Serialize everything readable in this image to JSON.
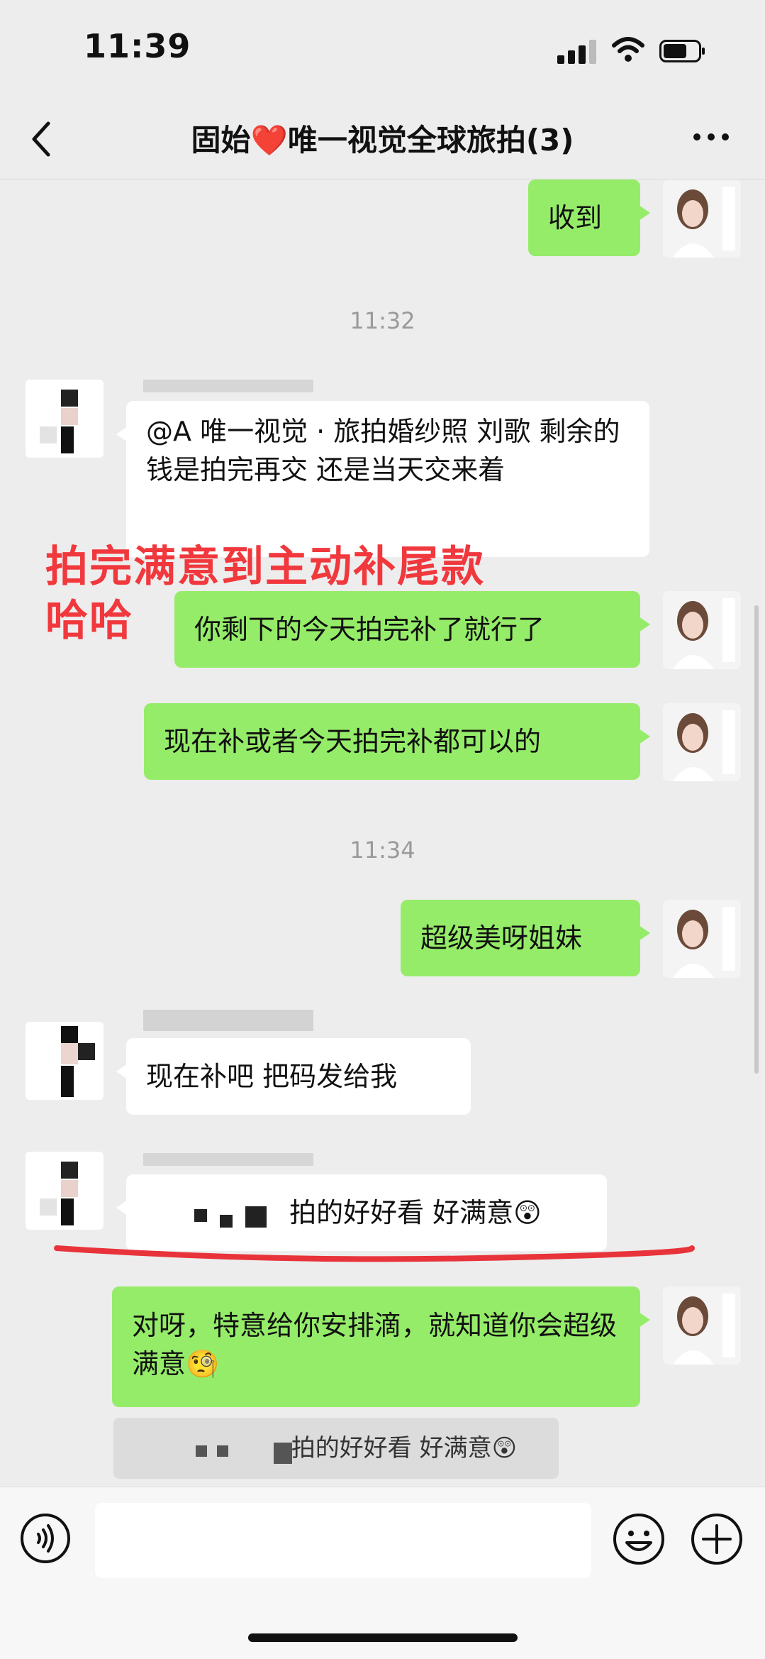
{
  "status_bar": {
    "time": "11:39"
  },
  "nav": {
    "title_prefix": "固始",
    "title_heart": "❤️",
    "title_suffix": "唯一视觉全球旅拍(3)"
  },
  "messages": {
    "m1": "收到",
    "ts1": "11:32",
    "m2": "@A 唯一视觉 · 旅拍婚纱照 刘歌 剩余的钱是拍完再交 还是当天交来着",
    "m3": "你剩下的今天拍完补了就行了",
    "m4": "现在补或者今天拍完补都可以的",
    "ts2": "11:34",
    "m5": "超级美呀姐妹",
    "m6": "现在补吧 把码发给我",
    "m7": "拍的好好看 好满意😲",
    "m8": "对呀，特意给你安排滴，就知道你会超级满意🧐",
    "quote": "拍的好好看 好满意😲"
  },
  "overlay": {
    "line1": "拍完满意到主动补尾款",
    "line2": "哈哈"
  },
  "colors": {
    "my_bubble": "#95ec69",
    "their_bubble": "#ffffff",
    "overlay_text": "#f0383d",
    "underline": "#e8333a"
  }
}
